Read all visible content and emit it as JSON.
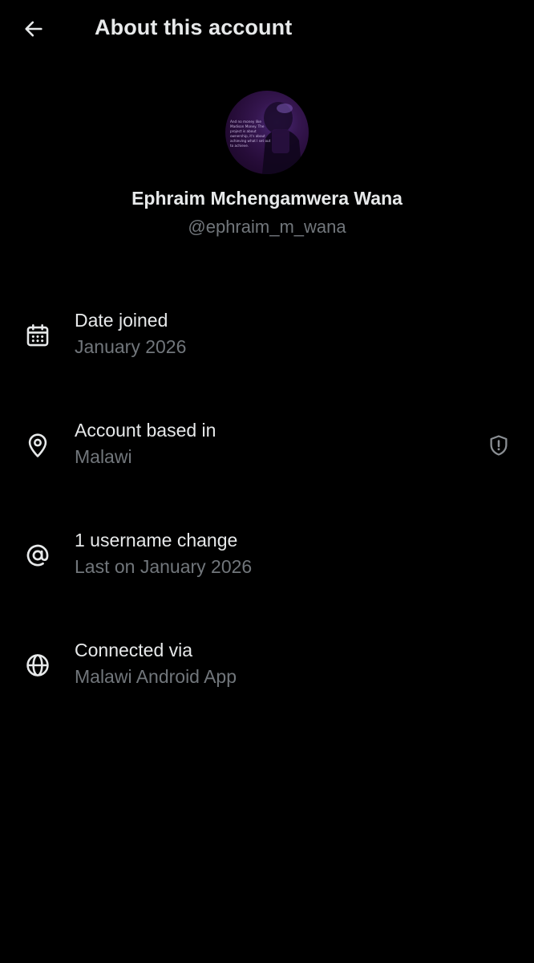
{
  "header": {
    "back_icon": "arrow-left-icon",
    "title": "About this account"
  },
  "profile": {
    "avatar_text": "And no money like Madison Money. The project is about ownership, it's about achieving what I set out to achieve.",
    "display_name": "Ephraim Mchengamwera Wana",
    "handle": "@ephraim_m_wana"
  },
  "details": [
    {
      "icon": "calendar-icon",
      "label": "Date joined",
      "value": "January 2026"
    },
    {
      "icon": "location-pin-icon",
      "label": "Account based in",
      "value": "Malawi",
      "trailing_icon": "shield-alert-icon"
    },
    {
      "icon": "at-sign-icon",
      "label": "1 username change",
      "value": "Last on January 2026"
    },
    {
      "icon": "globe-icon",
      "label": "Connected via",
      "value": "Malawi Android App"
    }
  ],
  "colors": {
    "background": "#000000",
    "primary_text": "#e7e9ea",
    "secondary_text": "#71767b"
  }
}
